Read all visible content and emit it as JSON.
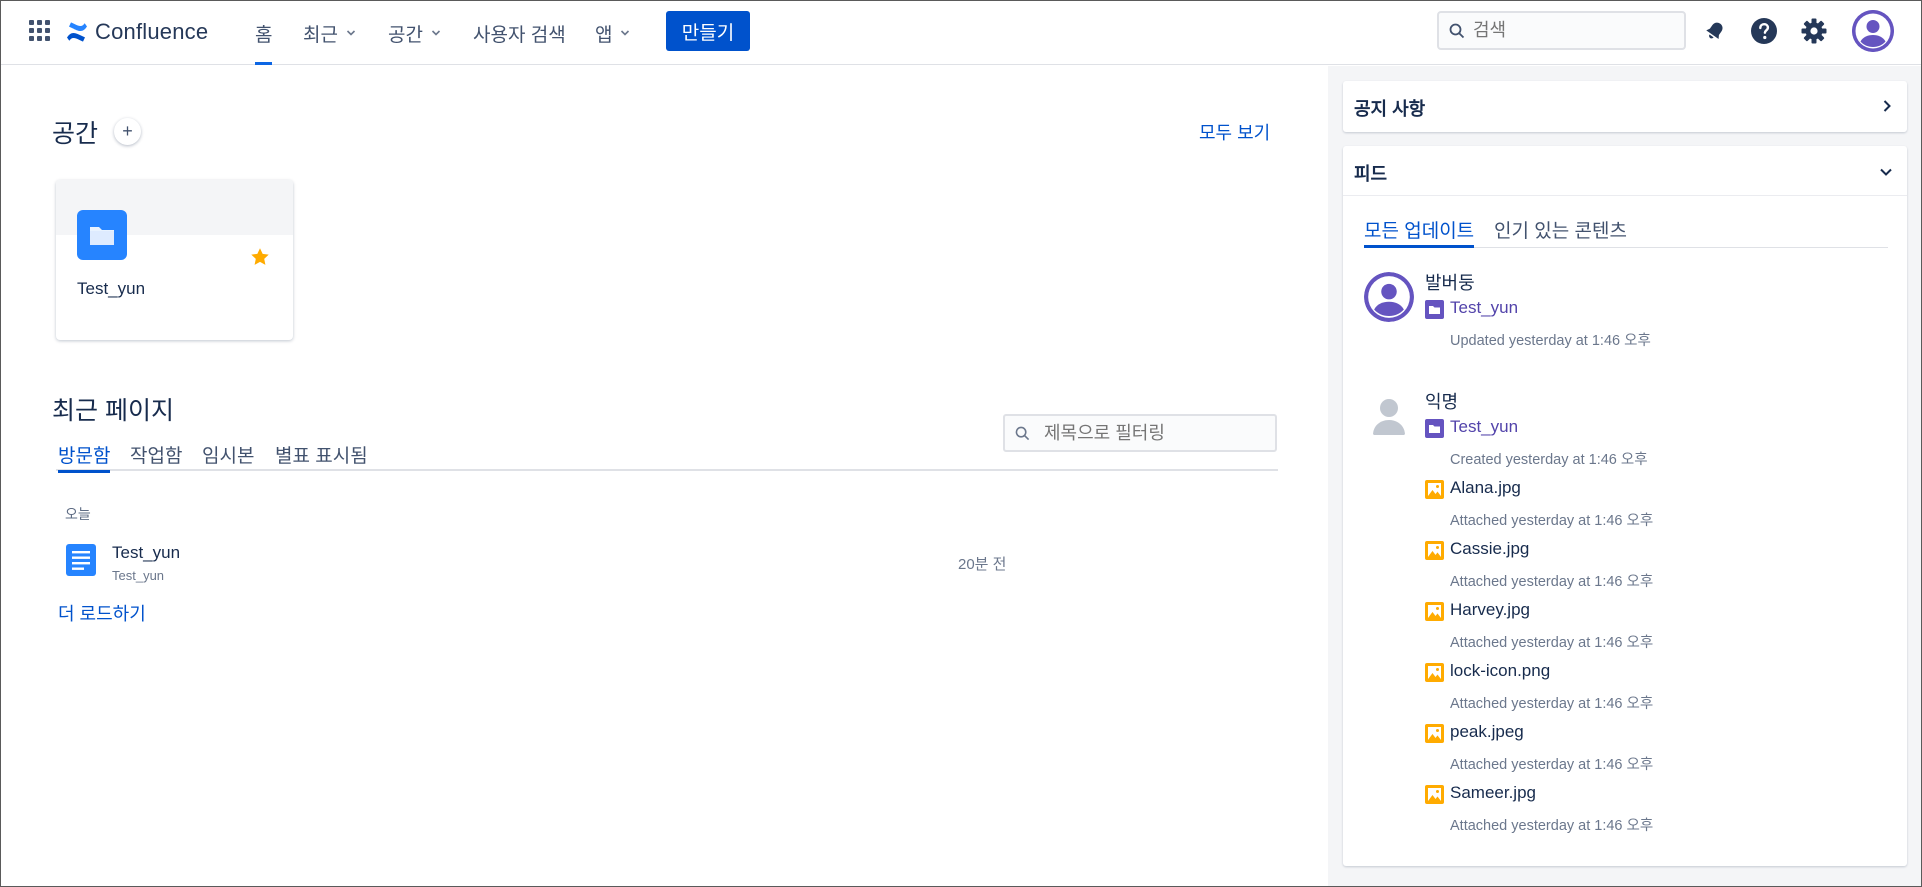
{
  "app": {
    "name": "Confluence"
  },
  "nav": {
    "items": [
      {
        "label": "홈",
        "active": true,
        "dropdown": false
      },
      {
        "label": "최근",
        "active": false,
        "dropdown": true
      },
      {
        "label": "공간",
        "active": false,
        "dropdown": true
      },
      {
        "label": "사용자 검색",
        "active": false,
        "dropdown": false
      },
      {
        "label": "앱",
        "active": false,
        "dropdown": true
      }
    ],
    "create_label": "만들기",
    "search_placeholder": "검색"
  },
  "spaces": {
    "title": "공간",
    "view_all": "모두 보기",
    "cards": [
      {
        "name": "Test_yun",
        "starred": true
      }
    ]
  },
  "recent": {
    "title": "최근 페이지",
    "tabs": [
      "방문함",
      "작업함",
      "임시본",
      "별표 표시됨"
    ],
    "filter_placeholder": "제목으로 필터링",
    "day_label": "오늘",
    "pages": [
      {
        "title": "Test_yun",
        "space": "Test_yun",
        "time": "20분 전"
      }
    ],
    "load_more": "더 로드하기"
  },
  "sidebar": {
    "notices": {
      "title": "공지 사항"
    },
    "feed": {
      "title": "피드",
      "tabs": [
        "모든 업데이트",
        "인기 있는 콘텐츠"
      ],
      "groups": [
        {
          "user": "발버둥",
          "items": [
            {
              "kind": "space",
              "name": "Test_yun",
              "meta": "Updated yesterday at 1:46 오후"
            }
          ]
        },
        {
          "user": "익명",
          "items": [
            {
              "kind": "space",
              "name": "Test_yun",
              "meta": "Created yesterday at 1:46 오후"
            },
            {
              "kind": "image",
              "name": "Alana.jpg",
              "meta": "Attached yesterday at 1:46 오후"
            },
            {
              "kind": "image",
              "name": "Cassie.jpg",
              "meta": "Attached yesterday at 1:46 오후"
            },
            {
              "kind": "image",
              "name": "Harvey.jpg",
              "meta": "Attached yesterday at 1:46 오후"
            },
            {
              "kind": "image",
              "name": "lock-icon.png",
              "meta": "Attached yesterday at 1:46 오후"
            },
            {
              "kind": "image",
              "name": "peak.jpeg",
              "meta": "Attached yesterday at 1:46 오후"
            },
            {
              "kind": "image",
              "name": "Sameer.jpg",
              "meta": "Attached yesterday at 1:46 오후"
            }
          ]
        }
      ]
    }
  },
  "colors": {
    "accent": "#0052cc",
    "nav_underline": "#0c66e4",
    "space_icon": "#2684ff",
    "star": "#ffab00",
    "feed_link": "#5243aa",
    "avatar": "#6554c0",
    "image_icon": "#ffab00"
  },
  "icons": {
    "app_switcher": "grid-icon",
    "search": "search-icon",
    "notifications": "bell-icon",
    "help": "help-icon",
    "settings": "gear-icon"
  }
}
